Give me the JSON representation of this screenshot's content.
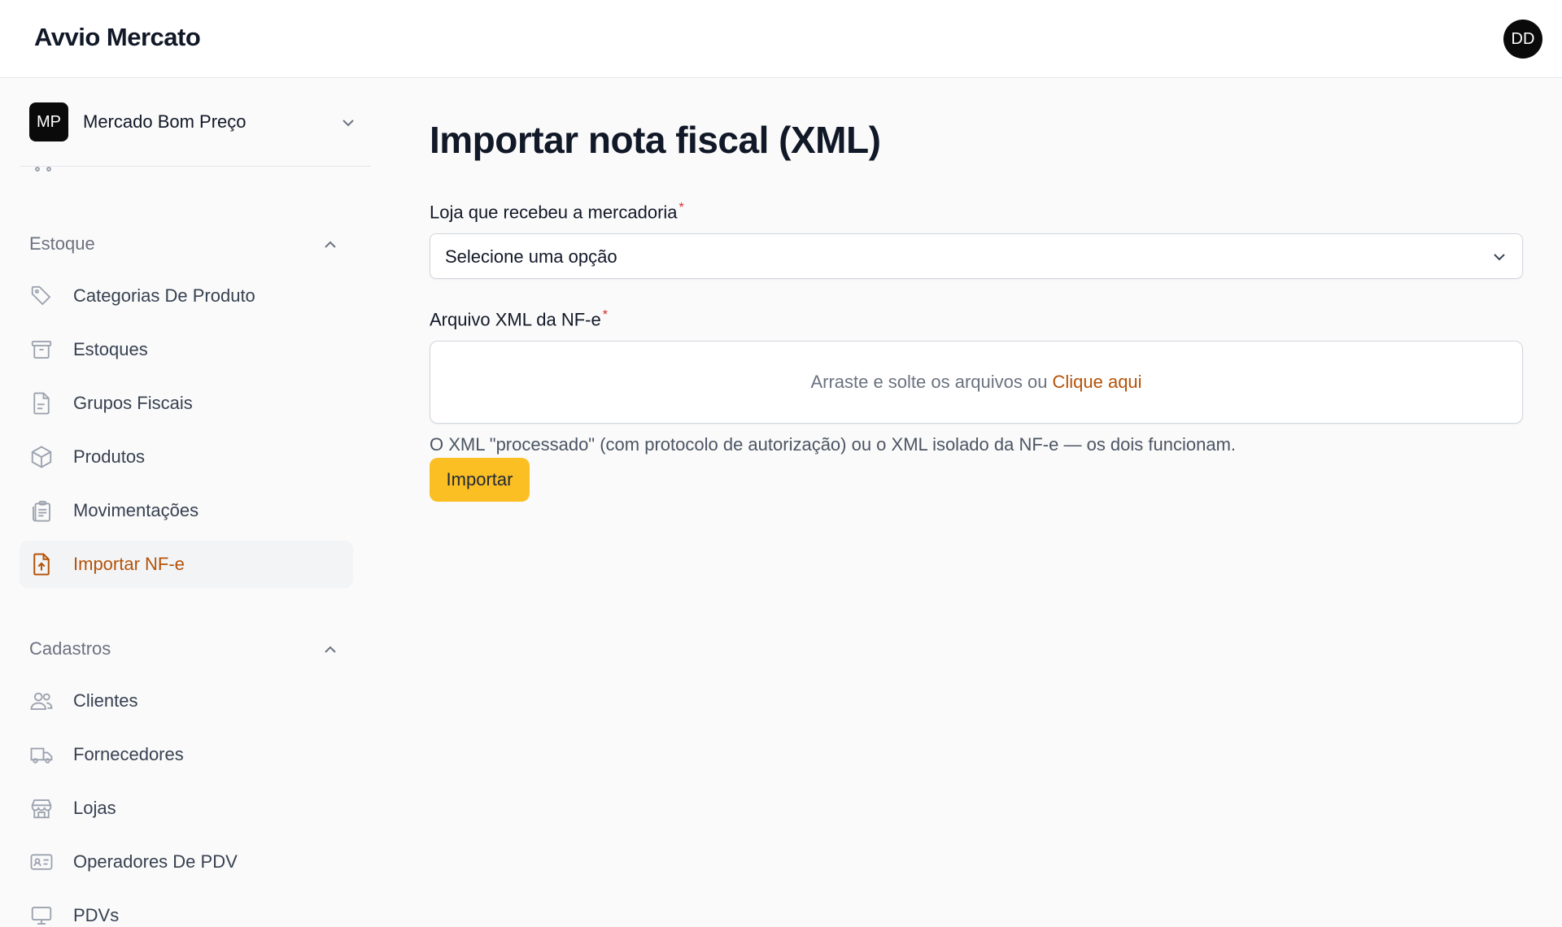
{
  "app": {
    "brand": "Avvio Mercato",
    "user_initials": "DD"
  },
  "tenant": {
    "initials": "MP",
    "name": "Mercado Bom Preço"
  },
  "sidebar": {
    "groups": [
      {
        "title": "Estoque",
        "items": [
          {
            "label": "Categorias De Produto",
            "icon": "tag-icon"
          },
          {
            "label": "Estoques",
            "icon": "archive-icon"
          },
          {
            "label": "Grupos Fiscais",
            "icon": "document-text-icon"
          },
          {
            "label": "Produtos",
            "icon": "cube-icon"
          },
          {
            "label": "Movimentações",
            "icon": "clipboard-list-icon"
          },
          {
            "label": "Importar NF-e",
            "icon": "document-upload-icon",
            "active": true
          }
        ]
      },
      {
        "title": "Cadastros",
        "items": [
          {
            "label": "Clientes",
            "icon": "users-icon"
          },
          {
            "label": "Fornecedores",
            "icon": "truck-icon"
          },
          {
            "label": "Lojas",
            "icon": "storefront-icon"
          },
          {
            "label": "Operadores De PDV",
            "icon": "id-card-icon"
          },
          {
            "label": "PDVs",
            "icon": "computer-icon"
          }
        ]
      }
    ]
  },
  "main": {
    "title": "Importar nota fiscal (XML)",
    "store_field": {
      "label": "Loja que recebeu a mercadoria",
      "required_mark": "*",
      "value": "Selecione uma opção"
    },
    "file_field": {
      "label": "Arquivo XML da NF-e",
      "required_mark": "*",
      "drop_text": "Arraste e solte os arquivos ou",
      "drop_link": "Clique aqui"
    },
    "hint": "O XML \"processado\" (com protocolo de autorização) ou o XML isolado da NF-e — os dois funcionam.",
    "submit_label": "Importar"
  },
  "colors": {
    "accent": "#b45309",
    "button": "#fbbf24",
    "required": "#dc2626"
  }
}
